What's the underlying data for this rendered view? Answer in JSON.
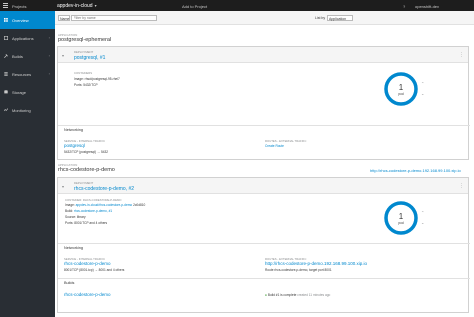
{
  "topbar": {
    "projects_label": "Projects",
    "project_name": "appdev-in-cloud",
    "add_to_project": "Add to Project",
    "help": "?",
    "user": "openshift-dev"
  },
  "sidebar": {
    "items": [
      {
        "label": "Overview",
        "icon": "dashboard-icon",
        "active": true
      },
      {
        "label": "Applications",
        "icon": "cubes-icon"
      },
      {
        "label": "Builds",
        "icon": "builds-icon"
      },
      {
        "label": "Resources",
        "icon": "resources-icon"
      },
      {
        "label": "Storage",
        "icon": "storage-icon"
      },
      {
        "label": "Monitoring",
        "icon": "monitoring-icon"
      }
    ]
  },
  "filter": {
    "select_value": "Name",
    "placeholder": "Filter by name",
    "list_by_label": "List by",
    "list_by_value": "Application"
  },
  "apps": [
    {
      "kicker": "APPLICATION",
      "name": "postgresql-ephemeral",
      "service": {
        "kicker": "DEPLOYMENT",
        "name": "postgresql, #1",
        "container_kicker": "CONTAINERS",
        "image_label": "Image:",
        "image_value": "rhscl/postgresql-95-rhel7",
        "ports_label": "Ports:",
        "ports_value": "5432/TCP",
        "pods": "1",
        "pods_unit": "pod",
        "networking": "Networking",
        "svc_kicker": "SERVICE - INTERNAL TRAFFIC",
        "svc_name": "postgresql",
        "svc_ports": "5432/TCP (postgresql) → 5432",
        "route_kicker": "ROUTES - EXTERNAL TRAFFIC",
        "route_link": "Create Route"
      }
    },
    {
      "kicker": "APPLICATION",
      "name": "rhcs-codestore-p-demo",
      "route": "http://rhcs-codestore-p-demo.192.168.99.100.xip.io",
      "service": {
        "kicker": "DEPLOYMENT",
        "name": "rhcs-codestore-p-demo, #2",
        "container_kicker": "CONTAINER: RHCS-CODESTORE-P-DEMO",
        "image_label": "Image:",
        "image_value": "appdev-in-cloud/rhcs-codestore-p-demo",
        "image_hash": "2c0d810",
        "build_label": "Build:",
        "build_value": "rhcs-codestore-p-demo, #1",
        "source_label": "Source:",
        "source_value": "library",
        "ports_label": "Ports:",
        "ports_value": "8001/TCP and 4 others",
        "pods": "1",
        "pods_unit": "pod",
        "networking": "Networking",
        "svc_kicker": "SERVICE - INTERNAL TRAFFIC",
        "svc_name": "rhcs-codestore-p-demo",
        "svc_ports": "8001/TCP (8001-tcp) → 8001 and 4 others",
        "route_kicker": "ROUTES - EXTERNAL TRAFFIC",
        "route_link": "http://rhcs-codestore-p-demo.192.168.99.100.xip.io",
        "route_detail": "Route rhcs-codestore-p-demo, target port 8001",
        "builds": "Builds",
        "build_link": "rhcs-codestore-p-demo",
        "build_status": "Build #1 is complete",
        "build_time": "created 11 minutes ago"
      }
    }
  ],
  "colors": {
    "accent": "#0088ce",
    "sidebar": "#292e34",
    "topbar": "#1d1d1d",
    "success": "#3f9c35"
  }
}
